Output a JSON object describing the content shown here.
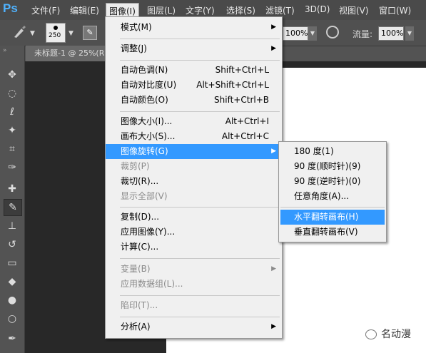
{
  "app": {
    "logo": "Ps"
  },
  "menubar": {
    "file": "文件(F)",
    "edit": "编辑(E)",
    "image": "图像(I)",
    "layer": "图层(L)",
    "type": "文字(Y)",
    "select": "选择(S)",
    "filter": "滤镜(T)",
    "3d": "3D(D)",
    "view": "视图(V)",
    "window": "窗口(W)"
  },
  "options": {
    "brush_size": "250",
    "opacity_value": "100%",
    "flow_label": "流量:",
    "flow_value": "100%"
  },
  "document": {
    "tab_title": "未标题-1 @ 25%(R"
  },
  "image_menu": {
    "mode": "模式(M)",
    "adjustments": "调整(J)",
    "auto_tone": {
      "label": "自动色调(N)",
      "shortcut": "Shift+Ctrl+L"
    },
    "auto_contrast": {
      "label": "自动对比度(U)",
      "shortcut": "Alt+Shift+Ctrl+L"
    },
    "auto_color": {
      "label": "自动颜色(O)",
      "shortcut": "Shift+Ctrl+B"
    },
    "image_size": {
      "label": "图像大小(I)...",
      "shortcut": "Alt+Ctrl+I"
    },
    "canvas_size": {
      "label": "画布大小(S)...",
      "shortcut": "Alt+Ctrl+C"
    },
    "image_rotation": "图像旋转(G)",
    "crop": "裁剪(P)",
    "trim": "裁切(R)...",
    "reveal_all": "显示全部(V)",
    "duplicate": "复制(D)...",
    "apply_image": "应用图像(Y)...",
    "calculations": "计算(C)...",
    "variables": "变量(B)",
    "apply_data_set": "应用数据组(L)...",
    "trap": "陷印(T)...",
    "analysis": "分析(A)"
  },
  "rotation_submenu": {
    "rotate_180": "180 度(1)",
    "rotate_90_cw": "90 度(顺时针)(9)",
    "rotate_90_ccw": "90 度(逆时针)(0)",
    "arbitrary": "任意角度(A)...",
    "flip_horizontal": "水平翻转画布(H)",
    "flip_vertical": "垂直翻转画布(V)"
  },
  "watermark": {
    "text": "名动漫"
  },
  "icons": {
    "move": "move-tool-icon",
    "marquee": "marquee-tool-icon",
    "lasso": "lasso-tool-icon",
    "wand": "magic-wand-tool-icon",
    "crop": "crop-tool-icon",
    "eyedropper": "eyedropper-tool-icon",
    "heal": "healing-brush-tool-icon",
    "brush": "brush-tool-icon",
    "stamp": "clone-stamp-tool-icon",
    "history": "history-brush-tool-icon",
    "eraser": "eraser-tool-icon",
    "bucket": "paint-bucket-tool-icon",
    "blur": "blur-tool-icon",
    "dodge": "dodge-tool-icon",
    "pen": "pen-tool-icon"
  },
  "colors": {
    "highlight": "#3399ff",
    "menu_bg": "#f0f0f0",
    "logo": "#4fb3ff"
  }
}
